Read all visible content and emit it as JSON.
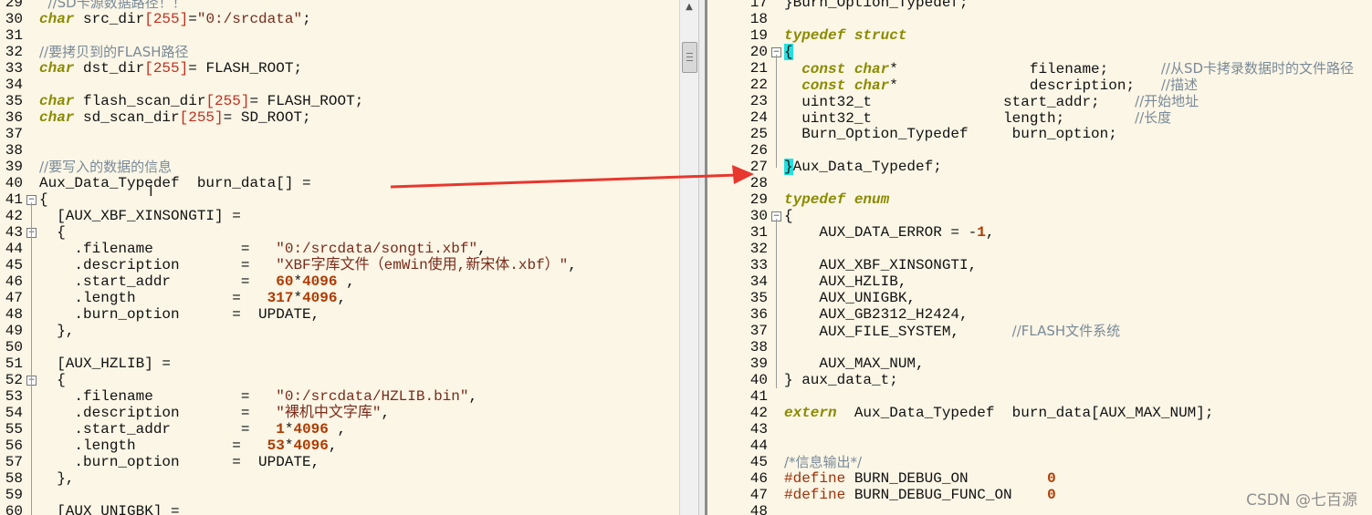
{
  "left": {
    "lines": [
      {
        "n": "29",
        "fold": "",
        "segs": [
          {
            "t": "  //SD卡源数据路径！！",
            "c": "cm"
          }
        ]
      },
      {
        "n": "30",
        "fold": "",
        "segs": [
          {
            "t": "char",
            "c": "kw"
          },
          {
            "t": " src_dir",
            "c": ""
          },
          {
            "t": "[255]",
            "c": "brk"
          },
          {
            "t": "=",
            "c": ""
          },
          {
            "t": "\"0:/srcdata\"",
            "c": "str"
          },
          {
            "t": ";",
            "c": ""
          }
        ]
      },
      {
        "n": "31",
        "fold": "",
        "segs": []
      },
      {
        "n": "32",
        "fold": "",
        "segs": [
          {
            "t": "//要拷贝到的FLASH路径",
            "c": "cm"
          }
        ]
      },
      {
        "n": "33",
        "fold": "",
        "segs": [
          {
            "t": "char",
            "c": "kw"
          },
          {
            "t": " dst_dir",
            "c": ""
          },
          {
            "t": "[255]",
            "c": "brk"
          },
          {
            "t": "= FLASH_ROOT;",
            "c": ""
          }
        ]
      },
      {
        "n": "34",
        "fold": "",
        "segs": []
      },
      {
        "n": "35",
        "fold": "",
        "segs": [
          {
            "t": "char",
            "c": "kw"
          },
          {
            "t": " flash_scan_dir",
            "c": ""
          },
          {
            "t": "[255]",
            "c": "brk"
          },
          {
            "t": "= FLASH_ROOT;",
            "c": ""
          }
        ]
      },
      {
        "n": "36",
        "fold": "",
        "segs": [
          {
            "t": "char",
            "c": "kw"
          },
          {
            "t": " sd_scan_dir",
            "c": ""
          },
          {
            "t": "[255]",
            "c": "brk"
          },
          {
            "t": "= SD_ROOT;",
            "c": ""
          }
        ]
      },
      {
        "n": "37",
        "fold": "",
        "segs": []
      },
      {
        "n": "38",
        "fold": "",
        "segs": []
      },
      {
        "n": "39",
        "fold": "",
        "segs": [
          {
            "t": "//要写入的数据的信息",
            "c": "cm"
          }
        ]
      },
      {
        "n": "40",
        "fold": "",
        "segs": [
          {
            "t": "Aux_Data_Typedef  burn_data[] =",
            "c": ""
          }
        ]
      },
      {
        "n": "41",
        "fold": "minus",
        "segs": [
          {
            "t": "{",
            "c": ""
          }
        ]
      },
      {
        "n": "42",
        "fold": "",
        "segs": [
          {
            "t": "  [AUX_XBF_XINSONGTI] =",
            "c": ""
          }
        ]
      },
      {
        "n": "43",
        "fold": "minus",
        "segs": [
          {
            "t": "  {",
            "c": ""
          }
        ]
      },
      {
        "n": "44",
        "fold": "",
        "segs": [
          {
            "t": "    .filename          =   ",
            "c": ""
          },
          {
            "t": "\"0:/srcdata/songti.xbf\"",
            "c": "str"
          },
          {
            "t": ",",
            "c": ""
          }
        ]
      },
      {
        "n": "45",
        "fold": "",
        "segs": [
          {
            "t": "    .description       =   ",
            "c": ""
          },
          {
            "t": "\"XBF字库文件（emWin使用,新宋体.xbf）\"",
            "c": "str"
          },
          {
            "t": ",",
            "c": ""
          }
        ]
      },
      {
        "n": "46",
        "fold": "",
        "segs": [
          {
            "t": "    .start_addr        =   ",
            "c": ""
          },
          {
            "t": "60",
            "c": "num"
          },
          {
            "t": "*",
            "c": ""
          },
          {
            "t": "4096",
            "c": "num"
          },
          {
            "t": " ,",
            "c": ""
          }
        ]
      },
      {
        "n": "47",
        "fold": "",
        "segs": [
          {
            "t": "    .length           =   ",
            "c": ""
          },
          {
            "t": "317",
            "c": "num"
          },
          {
            "t": "*",
            "c": ""
          },
          {
            "t": "4096",
            "c": "num"
          },
          {
            "t": ",",
            "c": ""
          }
        ]
      },
      {
        "n": "48",
        "fold": "",
        "segs": [
          {
            "t": "    .burn_option      =  UPDATE,",
            "c": ""
          }
        ]
      },
      {
        "n": "49",
        "fold": "",
        "segs": [
          {
            "t": "  },",
            "c": ""
          }
        ]
      },
      {
        "n": "50",
        "fold": "",
        "segs": []
      },
      {
        "n": "51",
        "fold": "",
        "segs": [
          {
            "t": "  [AUX_HZLIB] =",
            "c": ""
          }
        ]
      },
      {
        "n": "52",
        "fold": "minus",
        "segs": [
          {
            "t": "  {",
            "c": ""
          }
        ]
      },
      {
        "n": "53",
        "fold": "",
        "segs": [
          {
            "t": "    .filename          =   ",
            "c": ""
          },
          {
            "t": "\"0:/srcdata/HZLIB.bin\"",
            "c": "str"
          },
          {
            "t": ",",
            "c": ""
          }
        ]
      },
      {
        "n": "54",
        "fold": "",
        "segs": [
          {
            "t": "    .description       =   ",
            "c": ""
          },
          {
            "t": "\"裸机中文字库\"",
            "c": "str"
          },
          {
            "t": ",",
            "c": ""
          }
        ]
      },
      {
        "n": "55",
        "fold": "",
        "segs": [
          {
            "t": "    .start_addr        =   ",
            "c": ""
          },
          {
            "t": "1",
            "c": "num"
          },
          {
            "t": "*",
            "c": ""
          },
          {
            "t": "4096",
            "c": "num"
          },
          {
            "t": " ,",
            "c": ""
          }
        ]
      },
      {
        "n": "56",
        "fold": "",
        "segs": [
          {
            "t": "    .length           =   ",
            "c": ""
          },
          {
            "t": "53",
            "c": "num"
          },
          {
            "t": "*",
            "c": ""
          },
          {
            "t": "4096",
            "c": "num"
          },
          {
            "t": ",",
            "c": ""
          }
        ]
      },
      {
        "n": "57",
        "fold": "",
        "segs": [
          {
            "t": "    .burn_option      =  UPDATE,",
            "c": ""
          }
        ]
      },
      {
        "n": "58",
        "fold": "",
        "segs": [
          {
            "t": "  },",
            "c": ""
          }
        ]
      },
      {
        "n": "59",
        "fold": "",
        "segs": []
      },
      {
        "n": "60",
        "fold": "",
        "segs": [
          {
            "t": "  [AUX_UNIGBK] =",
            "c": ""
          }
        ]
      }
    ]
  },
  "right": {
    "lines": [
      {
        "n": "17",
        "fold": "",
        "segs": [
          {
            "t": "}Burn_Option_Typedef;",
            "c": ""
          }
        ]
      },
      {
        "n": "18",
        "fold": "",
        "segs": []
      },
      {
        "n": "19",
        "fold": "",
        "segs": [
          {
            "t": "typedef",
            "c": "kw"
          },
          {
            "t": " ",
            "c": ""
          },
          {
            "t": "struct",
            "c": "kw"
          }
        ]
      },
      {
        "n": "20",
        "fold": "minus",
        "segs": [
          {
            "t": "{",
            "c": "bhl"
          }
        ]
      },
      {
        "n": "21",
        "fold": "",
        "segs": [
          {
            "t": "  ",
            "c": ""
          },
          {
            "t": "const char",
            "c": "kw"
          },
          {
            "t": "*               filename;      ",
            "c": ""
          },
          {
            "t": "//从SD卡拷录数据时的文件路径",
            "c": "cm"
          }
        ]
      },
      {
        "n": "22",
        "fold": "",
        "segs": [
          {
            "t": "  ",
            "c": ""
          },
          {
            "t": "const char",
            "c": "kw"
          },
          {
            "t": "*               description;   ",
            "c": ""
          },
          {
            "t": "//描述",
            "c": "cm"
          }
        ]
      },
      {
        "n": "23",
        "fold": "",
        "segs": [
          {
            "t": "  uint32_t               start_addr;    ",
            "c": ""
          },
          {
            "t": "//开始地址",
            "c": "cm"
          }
        ]
      },
      {
        "n": "24",
        "fold": "",
        "segs": [
          {
            "t": "  uint32_t               length;        ",
            "c": ""
          },
          {
            "t": "//长度",
            "c": "cm"
          }
        ]
      },
      {
        "n": "25",
        "fold": "",
        "segs": [
          {
            "t": "  Burn_Option_Typedef     burn_option;",
            "c": ""
          }
        ]
      },
      {
        "n": "26",
        "fold": "",
        "segs": []
      },
      {
        "n": "27",
        "fold": "",
        "segs": [
          {
            "t": "}",
            "c": "bhl"
          },
          {
            "t": "Aux_Data_Typedef;",
            "c": ""
          }
        ]
      },
      {
        "n": "28",
        "fold": "",
        "segs": []
      },
      {
        "n": "29",
        "fold": "",
        "segs": [
          {
            "t": "typedef",
            "c": "kw"
          },
          {
            "t": " ",
            "c": ""
          },
          {
            "t": "enum",
            "c": "kw"
          }
        ]
      },
      {
        "n": "30",
        "fold": "minus",
        "segs": [
          {
            "t": "{",
            "c": ""
          }
        ]
      },
      {
        "n": "31",
        "fold": "",
        "segs": [
          {
            "t": "    AUX_DATA_ERROR = -",
            "c": ""
          },
          {
            "t": "1",
            "c": "num"
          },
          {
            "t": ",",
            "c": ""
          }
        ]
      },
      {
        "n": "32",
        "fold": "",
        "segs": []
      },
      {
        "n": "33",
        "fold": "",
        "segs": [
          {
            "t": "    AUX_XBF_XINSONGTI,",
            "c": ""
          }
        ]
      },
      {
        "n": "34",
        "fold": "",
        "segs": [
          {
            "t": "    AUX_HZLIB,",
            "c": ""
          }
        ]
      },
      {
        "n": "35",
        "fold": "",
        "segs": [
          {
            "t": "    AUX_UNIGBK,",
            "c": ""
          }
        ]
      },
      {
        "n": "36",
        "fold": "",
        "segs": [
          {
            "t": "    AUX_GB2312_H2424,",
            "c": ""
          }
        ]
      },
      {
        "n": "37",
        "fold": "",
        "segs": [
          {
            "t": "    AUX_FILE_SYSTEM,      ",
            "c": ""
          },
          {
            "t": "//FLASH文件系统",
            "c": "cm"
          }
        ]
      },
      {
        "n": "38",
        "fold": "",
        "segs": []
      },
      {
        "n": "39",
        "fold": "",
        "segs": [
          {
            "t": "    AUX_MAX_NUM,",
            "c": ""
          }
        ]
      },
      {
        "n": "40",
        "fold": "",
        "segs": [
          {
            "t": "} aux_data_t;",
            "c": ""
          }
        ]
      },
      {
        "n": "41",
        "fold": "",
        "segs": []
      },
      {
        "n": "42",
        "fold": "",
        "segs": [
          {
            "t": "extern",
            "c": "kw"
          },
          {
            "t": "  Aux_Data_Typedef  burn_data[AUX_MAX_NUM];",
            "c": ""
          }
        ]
      },
      {
        "n": "43",
        "fold": "",
        "segs": []
      },
      {
        "n": "44",
        "fold": "",
        "segs": []
      },
      {
        "n": "45",
        "fold": "",
        "segs": [
          {
            "t": "/*信息输出*/",
            "c": "cm"
          }
        ]
      },
      {
        "n": "46",
        "fold": "",
        "segs": [
          {
            "t": "#define",
            "c": "pp"
          },
          {
            "t": " BURN_DEBUG_ON         ",
            "c": ""
          },
          {
            "t": "0",
            "c": "num"
          }
        ]
      },
      {
        "n": "47",
        "fold": "",
        "segs": [
          {
            "t": "#define",
            "c": "pp"
          },
          {
            "t": " BURN_DEBUG_FUNC_ON    ",
            "c": ""
          },
          {
            "t": "0",
            "c": "num"
          }
        ]
      },
      {
        "n": "48",
        "fold": "",
        "segs": []
      }
    ]
  },
  "icons": {
    "scroll_up": "chevron-up-icon",
    "arrow": "red-annotation-arrow",
    "cursor": "text-cursor-icon"
  },
  "colors": {
    "background": "#fbf6e6",
    "keyword": "#8b8b00",
    "string": "#7a2a1a",
    "number": "#b03a00",
    "comment": "#7a8a98",
    "brace_highlight": "#22e0e0",
    "annotation_arrow": "#e8372e"
  },
  "watermark": "CSDN @七百源"
}
